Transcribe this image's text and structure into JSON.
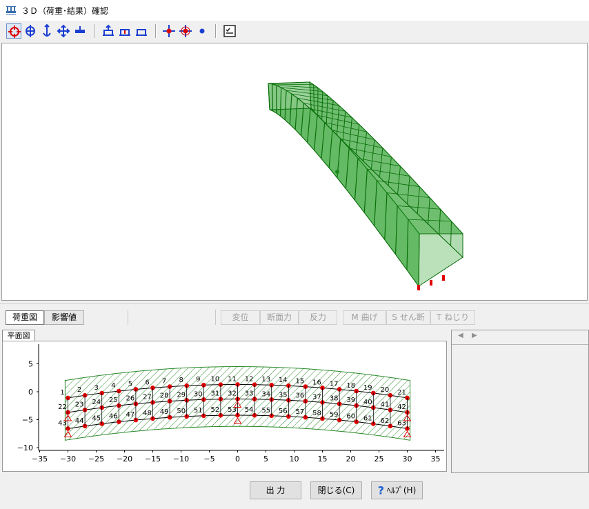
{
  "window": {
    "title": "３Ｄ（荷重･結果）確認"
  },
  "toolbar": {
    "groups": [
      [
        "rotate-free-icon",
        "rotate-x-icon",
        "rotate-y-icon",
        "move-icon",
        "zoom-icon"
      ],
      [
        "view-front-icon",
        "view-top-icon",
        "view-side-icon"
      ],
      [
        "node-move-icon",
        "node-select-icon",
        "point-icon"
      ],
      [
        "settings-icon"
      ]
    ]
  },
  "tabs": {
    "load_view": "荷重図",
    "influence_view": "影響値"
  },
  "result_buttons": [
    "変位",
    "断面力",
    "反力",
    "M 曲げ",
    "S せん断",
    "T ねじり"
  ],
  "plan": {
    "tab_label": "平面図",
    "y_ticks": [
      "5",
      "0",
      "−5",
      "−10"
    ],
    "x_ticks": [
      "−35",
      "−30",
      "−25",
      "−20",
      "−15",
      "−10",
      "−5",
      "0",
      "5",
      "10",
      "15",
      "20",
      "25",
      "30",
      "35"
    ],
    "top_labels": [
      "1",
      "2",
      "3",
      "4",
      "5",
      "6",
      "7",
      "8",
      "9",
      "10",
      "11",
      "12",
      "13",
      "14",
      "15",
      "16",
      "17",
      "18",
      "19",
      "20",
      "21"
    ],
    "mid_labels": [
      "22",
      "23",
      "24",
      "25",
      "26",
      "27",
      "28",
      "29",
      "30",
      "31",
      "32",
      "33",
      "34",
      "35",
      "36",
      "37",
      "38",
      "39",
      "40",
      "41",
      "42"
    ],
    "bot_labels": [
      "43",
      "44",
      "45",
      "46",
      "47",
      "48",
      "49",
      "50",
      "51",
      "52",
      "53",
      "54",
      "55",
      "56",
      "57",
      "58",
      "59",
      "60",
      "61",
      "62",
      "63"
    ],
    "colors": {
      "hatch": "#2a8a2a",
      "node": "#e00000",
      "support": "#e00000",
      "member": "#000000"
    }
  },
  "bottom": {
    "output_label": "出 力",
    "close_label": "閉じる(C)",
    "help_label": "ﾍﾙﾌﾟ(H)"
  },
  "view3d": {
    "colors": {
      "fill": "#1f9a1f",
      "edge": "#0a6e0a"
    }
  }
}
